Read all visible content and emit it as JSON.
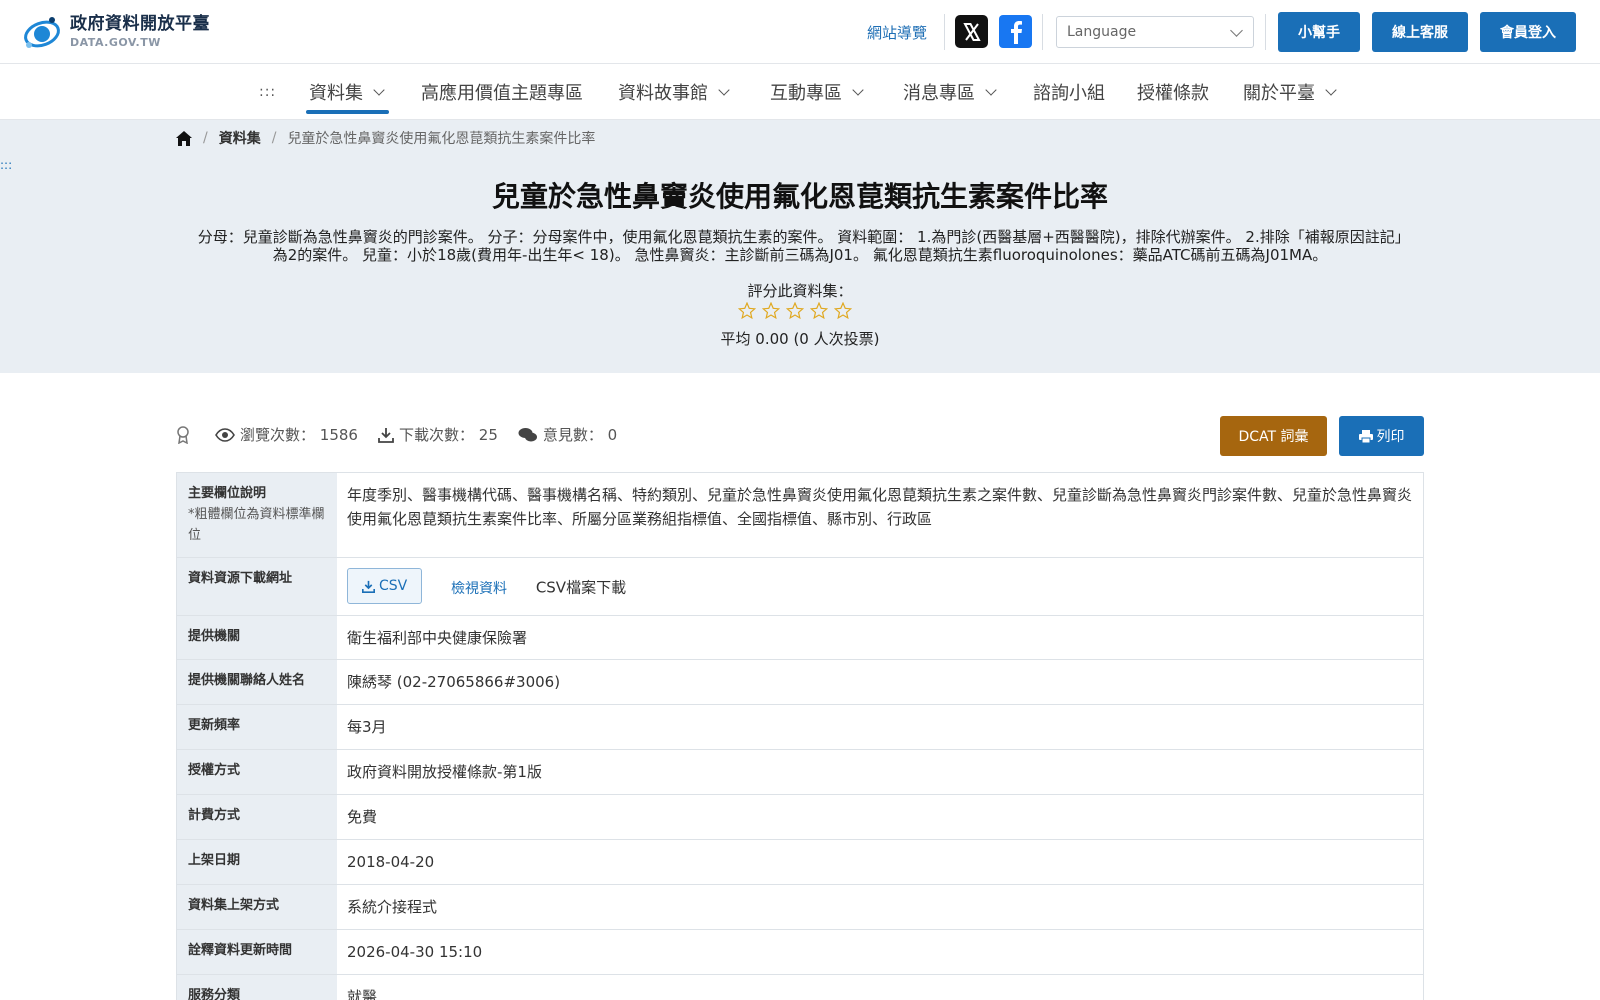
{
  "header": {
    "logo_zh": "政府資料開放平臺",
    "logo_en": "DATA.GOV.TW",
    "sitemap": "網站導覽",
    "language_placeholder": "Language",
    "buttons": {
      "helper": "小幫手",
      "support": "線上客服",
      "login": "會員登入"
    }
  },
  "nav": {
    "access_key": ":::",
    "items": [
      "資料集",
      "高應用價值主題專區",
      "資料故事館",
      "互動專區",
      "消息專區",
      "諮詢小組",
      "授權條款",
      "關於平臺"
    ]
  },
  "breadcrumb": {
    "datasets": "資料集",
    "current": "兒童於急性鼻竇炎使用氟化恩菎類抗生素案件比率"
  },
  "hero": {
    "access_key": ":::",
    "title": "兒童於急性鼻竇炎使用氟化恩菎類抗生素案件比率",
    "description": "分母：兒童診斷為急性鼻竇炎的門診案件。 分子：分母案件中，使用氟化恩菎類抗生素的案件。 資料範圍： 1.為門診(西醫基層+西醫醫院)，排除代辦案件。 2.排除「補報原因註記」為2的案件。 兒童：小於18歲(費用年-出生年< 18)。 急性鼻竇炎：主診斷前三碼為J01。 氟化恩菎類抗生素fluoroquinolones：藥品ATC碼前五碼為J01MA。",
    "rate_label": "評分此資料集：",
    "rating_value": 0,
    "rating_max": 5,
    "rating_summary": "平均 0.00 (0 人次投票)"
  },
  "stats": {
    "views_label": "瀏覽次數：",
    "views": "1586",
    "downloads_label": "下載次數：",
    "downloads": "25",
    "comments_label": "意見數：",
    "comments": "0"
  },
  "actions": {
    "dcat": "DCAT 詞彙",
    "print": "列印"
  },
  "table": {
    "fields_label": "主要欄位說明",
    "fields_note": "*粗體欄位為資料標準欄位",
    "fields_value": "年度季別、醫事機構代碼、醫事機構名稱、特約類別、兒童於急性鼻竇炎使用氟化恩菎類抗生素之案件數、兒童診斷為急性鼻竇炎門診案件數、兒童於急性鼻竇炎使用氟化恩菎類抗生素案件比率、所屬分區業務組指標值、全國指標值、縣市別、行政區",
    "resource_label": "資料資源下載網址",
    "csv_chip": "CSV",
    "view_data": "檢視資料",
    "csv_desc": "CSV檔案下載",
    "provider_label": "提供機關",
    "provider": "衛生福利部中央健康保險署",
    "contact_label": "提供機關聯絡人姓名",
    "contact": "陳綉琴 (02-27065866#3006)",
    "frequency_label": "更新頻率",
    "frequency": "每3月",
    "license_label": "授權方式",
    "license": "政府資料開放授權條款-第1版",
    "fee_label": "計費方式",
    "fee": "免費",
    "published_label": "上架日期",
    "published": "2018-04-20",
    "method_label": "資料集上架方式",
    "method": "系統介接程式",
    "meta_updated_label": "詮釋資料更新時間",
    "meta_updated": "2026-04-30 15:10",
    "service_label": "服務分類",
    "service": "就醫"
  },
  "colors": {
    "primary": "#1a6fb7",
    "dcat": "#a6660f",
    "hero_bg": "#e9eef3",
    "star": "#e0a820"
  }
}
